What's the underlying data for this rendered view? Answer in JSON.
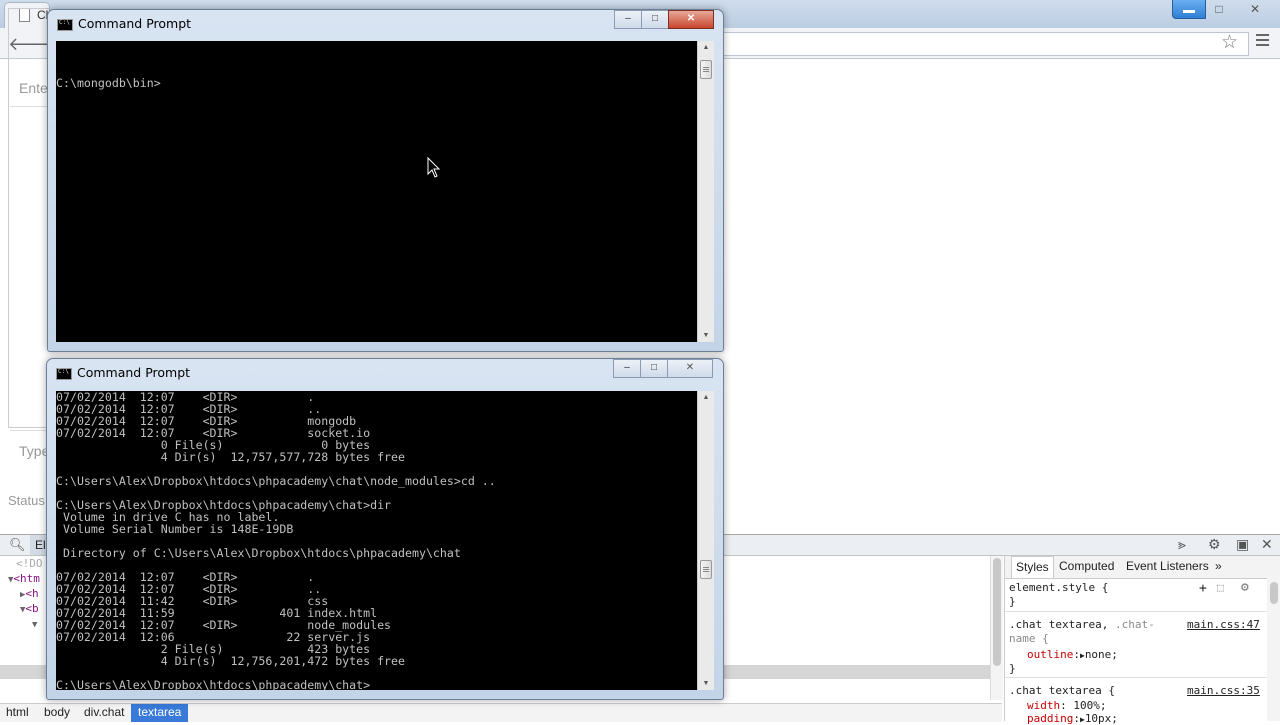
{
  "browser": {
    "tab_title": "Ch",
    "chat": {
      "name_placeholder": "Ente",
      "textarea_placeholder": "Type",
      "status_label": "Status"
    },
    "window_controls": {
      "minimize": "–",
      "maximize": "□",
      "close": "✕"
    },
    "icons": [
      "back-arrow-icon",
      "star-icon",
      "menu-icon"
    ]
  },
  "devtools": {
    "elements_tab": "Ele",
    "dom_lines": [
      {
        "prefix": "",
        "text": "<!DO",
        "class": "grey"
      },
      {
        "prefix": "▼",
        "text": "<htm",
        "class": "tag"
      },
      {
        "prefix": "  ▶",
        "text": "<h",
        "class": "tag"
      },
      {
        "prefix": "  ▼",
        "text": "<b",
        "class": "tag"
      },
      {
        "prefix": "    ▼",
        "text": "",
        "class": "tag"
      }
    ],
    "breadcrumbs": [
      "html",
      "body",
      "div.chat",
      "textarea"
    ],
    "styles": {
      "tabs": [
        "Styles",
        "Computed",
        "Event Listeners"
      ],
      "more_tabs": "»",
      "element_style": "element.style {",
      "close_brace": "}",
      "rule1_selector_a": ".chat textarea,",
      "rule1_selector_b": " .chat-",
      "rule1_selector_c": "name {",
      "rule1_source": "main.css:47",
      "rule1_prop": "outline",
      "rule1_value": "none;",
      "rule2_selector": ".chat textarea {",
      "rule2_source": "main.css:35",
      "rule2_prop1": "width",
      "rule2_value1": "100%;",
      "rule2_prop2": "padding",
      "rule2_value2": "10px;"
    }
  },
  "console_top": {
    "title": "Command Prompt",
    "lines": [
      "C:\\mongodb\\bin>"
    ]
  },
  "console_bottom": {
    "title": "Command Prompt",
    "lines": [
      "07/02/2014  12:07    <DIR>          .",
      "07/02/2014  12:07    <DIR>          ..",
      "07/02/2014  12:07    <DIR>          mongodb",
      "07/02/2014  12:07    <DIR>          socket.io",
      "               0 File(s)              0 bytes",
      "               4 Dir(s)  12,757,577,728 bytes free",
      "",
      "C:\\Users\\Alex\\Dropbox\\htdocs\\phpacademy\\chat\\node_modules>cd ..",
      "",
      "C:\\Users\\Alex\\Dropbox\\htdocs\\phpacademy\\chat>dir",
      " Volume in drive C has no label.",
      " Volume Serial Number is 148E-19DB",
      "",
      " Directory of C:\\Users\\Alex\\Dropbox\\htdocs\\phpacademy\\chat",
      "",
      "07/02/2014  12:07    <DIR>          .",
      "07/02/2014  12:07    <DIR>          ..",
      "07/02/2014  11:42    <DIR>          css",
      "07/02/2014  11:59               401 index.html",
      "07/02/2014  12:07    <DIR>          node_modules",
      "07/02/2014  12:06                22 server.js",
      "               2 File(s)            423 bytes",
      "               4 Dir(s)  12,756,201,472 bytes free",
      "",
      "C:\\Users\\Alex\\Dropbox\\htdocs\\phpacademy\\chat>"
    ]
  },
  "cmd_controls": {
    "minimize": "–",
    "maximize": "□",
    "close": "✕"
  }
}
